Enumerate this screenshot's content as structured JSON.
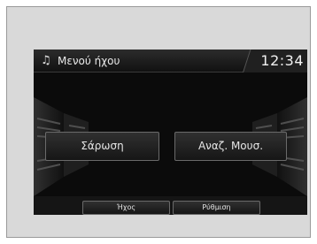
{
  "header": {
    "icon": "music-note-icon",
    "title": "Μενού ήχου",
    "time": "12:34"
  },
  "main_buttons": {
    "scan": "Σάρωση",
    "music_search": "Αναζ. Μουσ."
  },
  "bottom_tabs": {
    "sound": "Ήχος",
    "settings": "Ρύθμιση"
  },
  "colors": {
    "screen_bg": "#0b0b0b",
    "frame_bg": "#d9d9d9",
    "text": "#e6e6e6"
  }
}
